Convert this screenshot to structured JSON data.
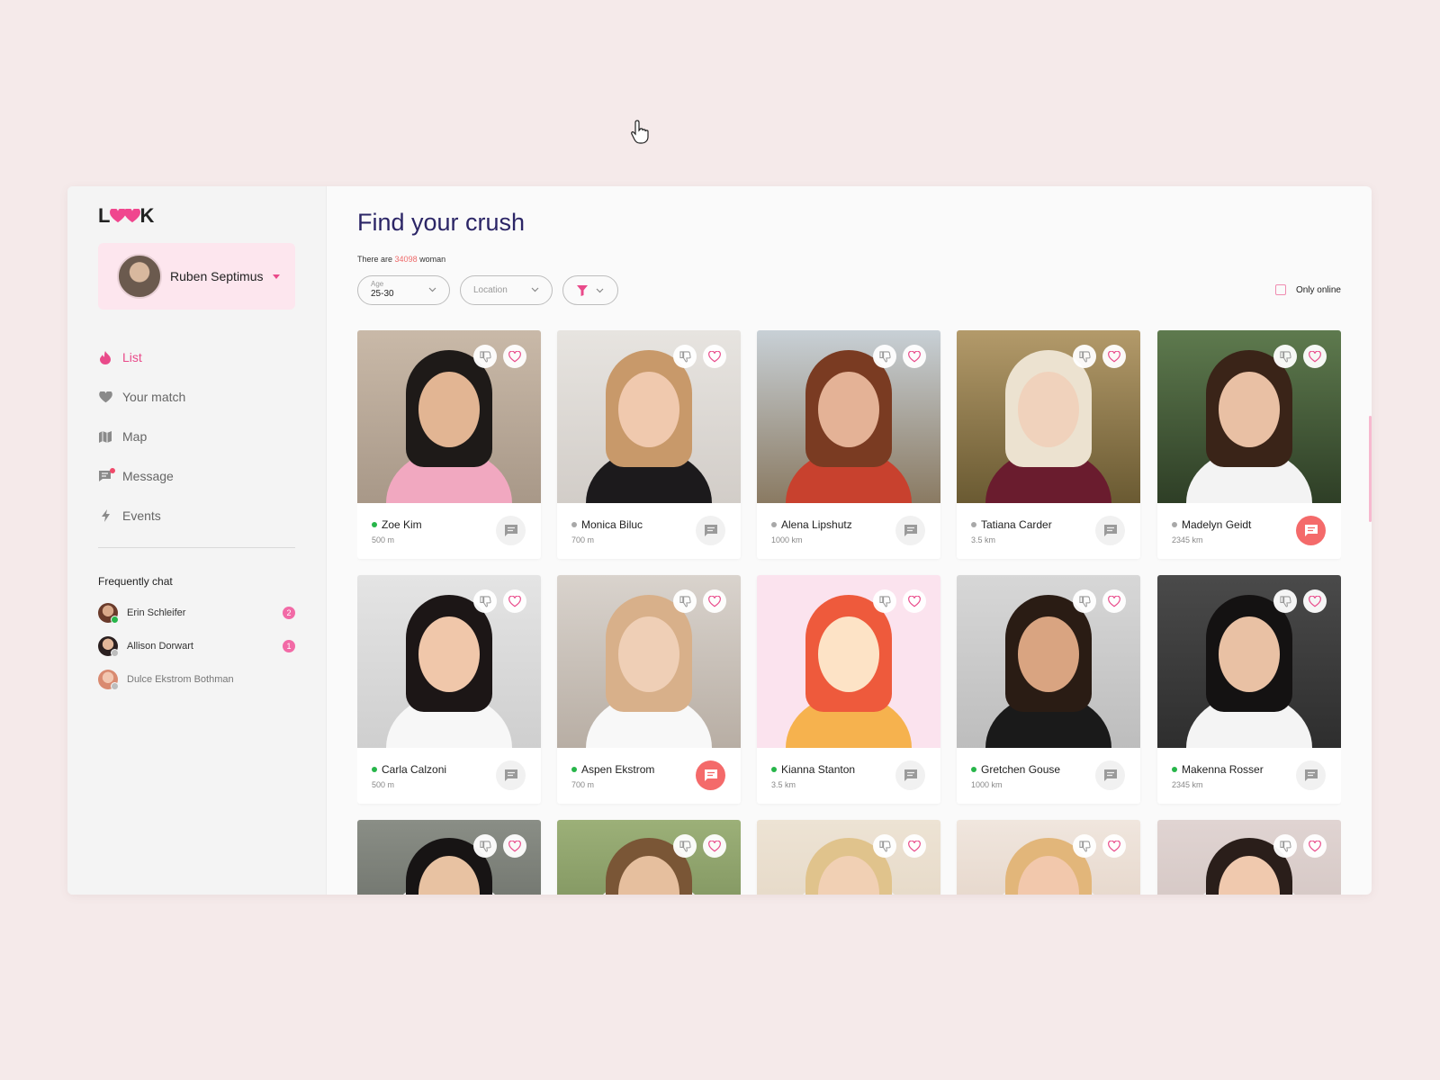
{
  "app": {
    "logo_letters": [
      "L",
      "K"
    ],
    "user_name": "Ruben Septimus"
  },
  "nav": [
    {
      "label": "List",
      "icon": "fire-icon",
      "active": true
    },
    {
      "label": "Your match",
      "icon": "heart-icon",
      "active": false
    },
    {
      "label": "Map",
      "icon": "map-icon",
      "active": false
    },
    {
      "label": "Message",
      "icon": "message-icon",
      "active": false
    },
    {
      "label": "Events",
      "icon": "bolt-icon",
      "active": false
    }
  ],
  "frequent_chat": {
    "title": "Frequently chat",
    "items": [
      {
        "name": "Erin Schleifer",
        "badge": "2",
        "status": "online"
      },
      {
        "name": "Allison Dorwart",
        "badge": "1",
        "status": "offline"
      },
      {
        "name": "Dulce Ekstrom Bothman",
        "badge": "",
        "status": "offline"
      }
    ]
  },
  "main": {
    "title": "Find your crush",
    "subtitle_prefix": "There are",
    "subtitle_count": "34098",
    "subtitle_suffix": "woman",
    "filters": {
      "age_label": "Age",
      "age_value": "25-30",
      "location_placeholder": "Location"
    },
    "only_online_label": "Only online"
  },
  "colors": {
    "accent": "#e94a8a",
    "title": "#2b2566",
    "online": "#27b54a",
    "offline": "#a8a8a8",
    "chat_hot": "#f46a6a"
  },
  "profiles": [
    {
      "name": "Zoe Kim",
      "distance": "500 m",
      "online": true,
      "chat_hot": false
    },
    {
      "name": "Monica Biluc",
      "distance": "700 m",
      "online": false,
      "chat_hot": false
    },
    {
      "name": "Alena Lipshutz",
      "distance": "1000 km",
      "online": false,
      "chat_hot": false
    },
    {
      "name": "Tatiana Carder",
      "distance": "3.5 km",
      "online": false,
      "chat_hot": false
    },
    {
      "name": "Madelyn Geidt",
      "distance": "2345 km",
      "online": false,
      "chat_hot": true
    },
    {
      "name": "Carla Calzoni",
      "distance": "500 m",
      "online": true,
      "chat_hot": false
    },
    {
      "name": "Aspen Ekstrom",
      "distance": "700 m",
      "online": true,
      "chat_hot": true
    },
    {
      "name": "Kianna Stanton",
      "distance": "3.5 km",
      "online": true,
      "chat_hot": false
    },
    {
      "name": "Gretchen Gouse",
      "distance": "1000 km",
      "online": true,
      "chat_hot": false
    },
    {
      "name": "Makenna Rosser",
      "distance": "2345 km",
      "online": true,
      "chat_hot": false
    },
    {
      "name": "",
      "distance": "",
      "online": false,
      "chat_hot": false
    },
    {
      "name": "",
      "distance": "",
      "online": false,
      "chat_hot": false
    },
    {
      "name": "",
      "distance": "",
      "online": false,
      "chat_hot": false
    },
    {
      "name": "",
      "distance": "",
      "online": false,
      "chat_hot": false
    },
    {
      "name": "",
      "distance": "",
      "online": false,
      "chat_hot": false
    }
  ]
}
